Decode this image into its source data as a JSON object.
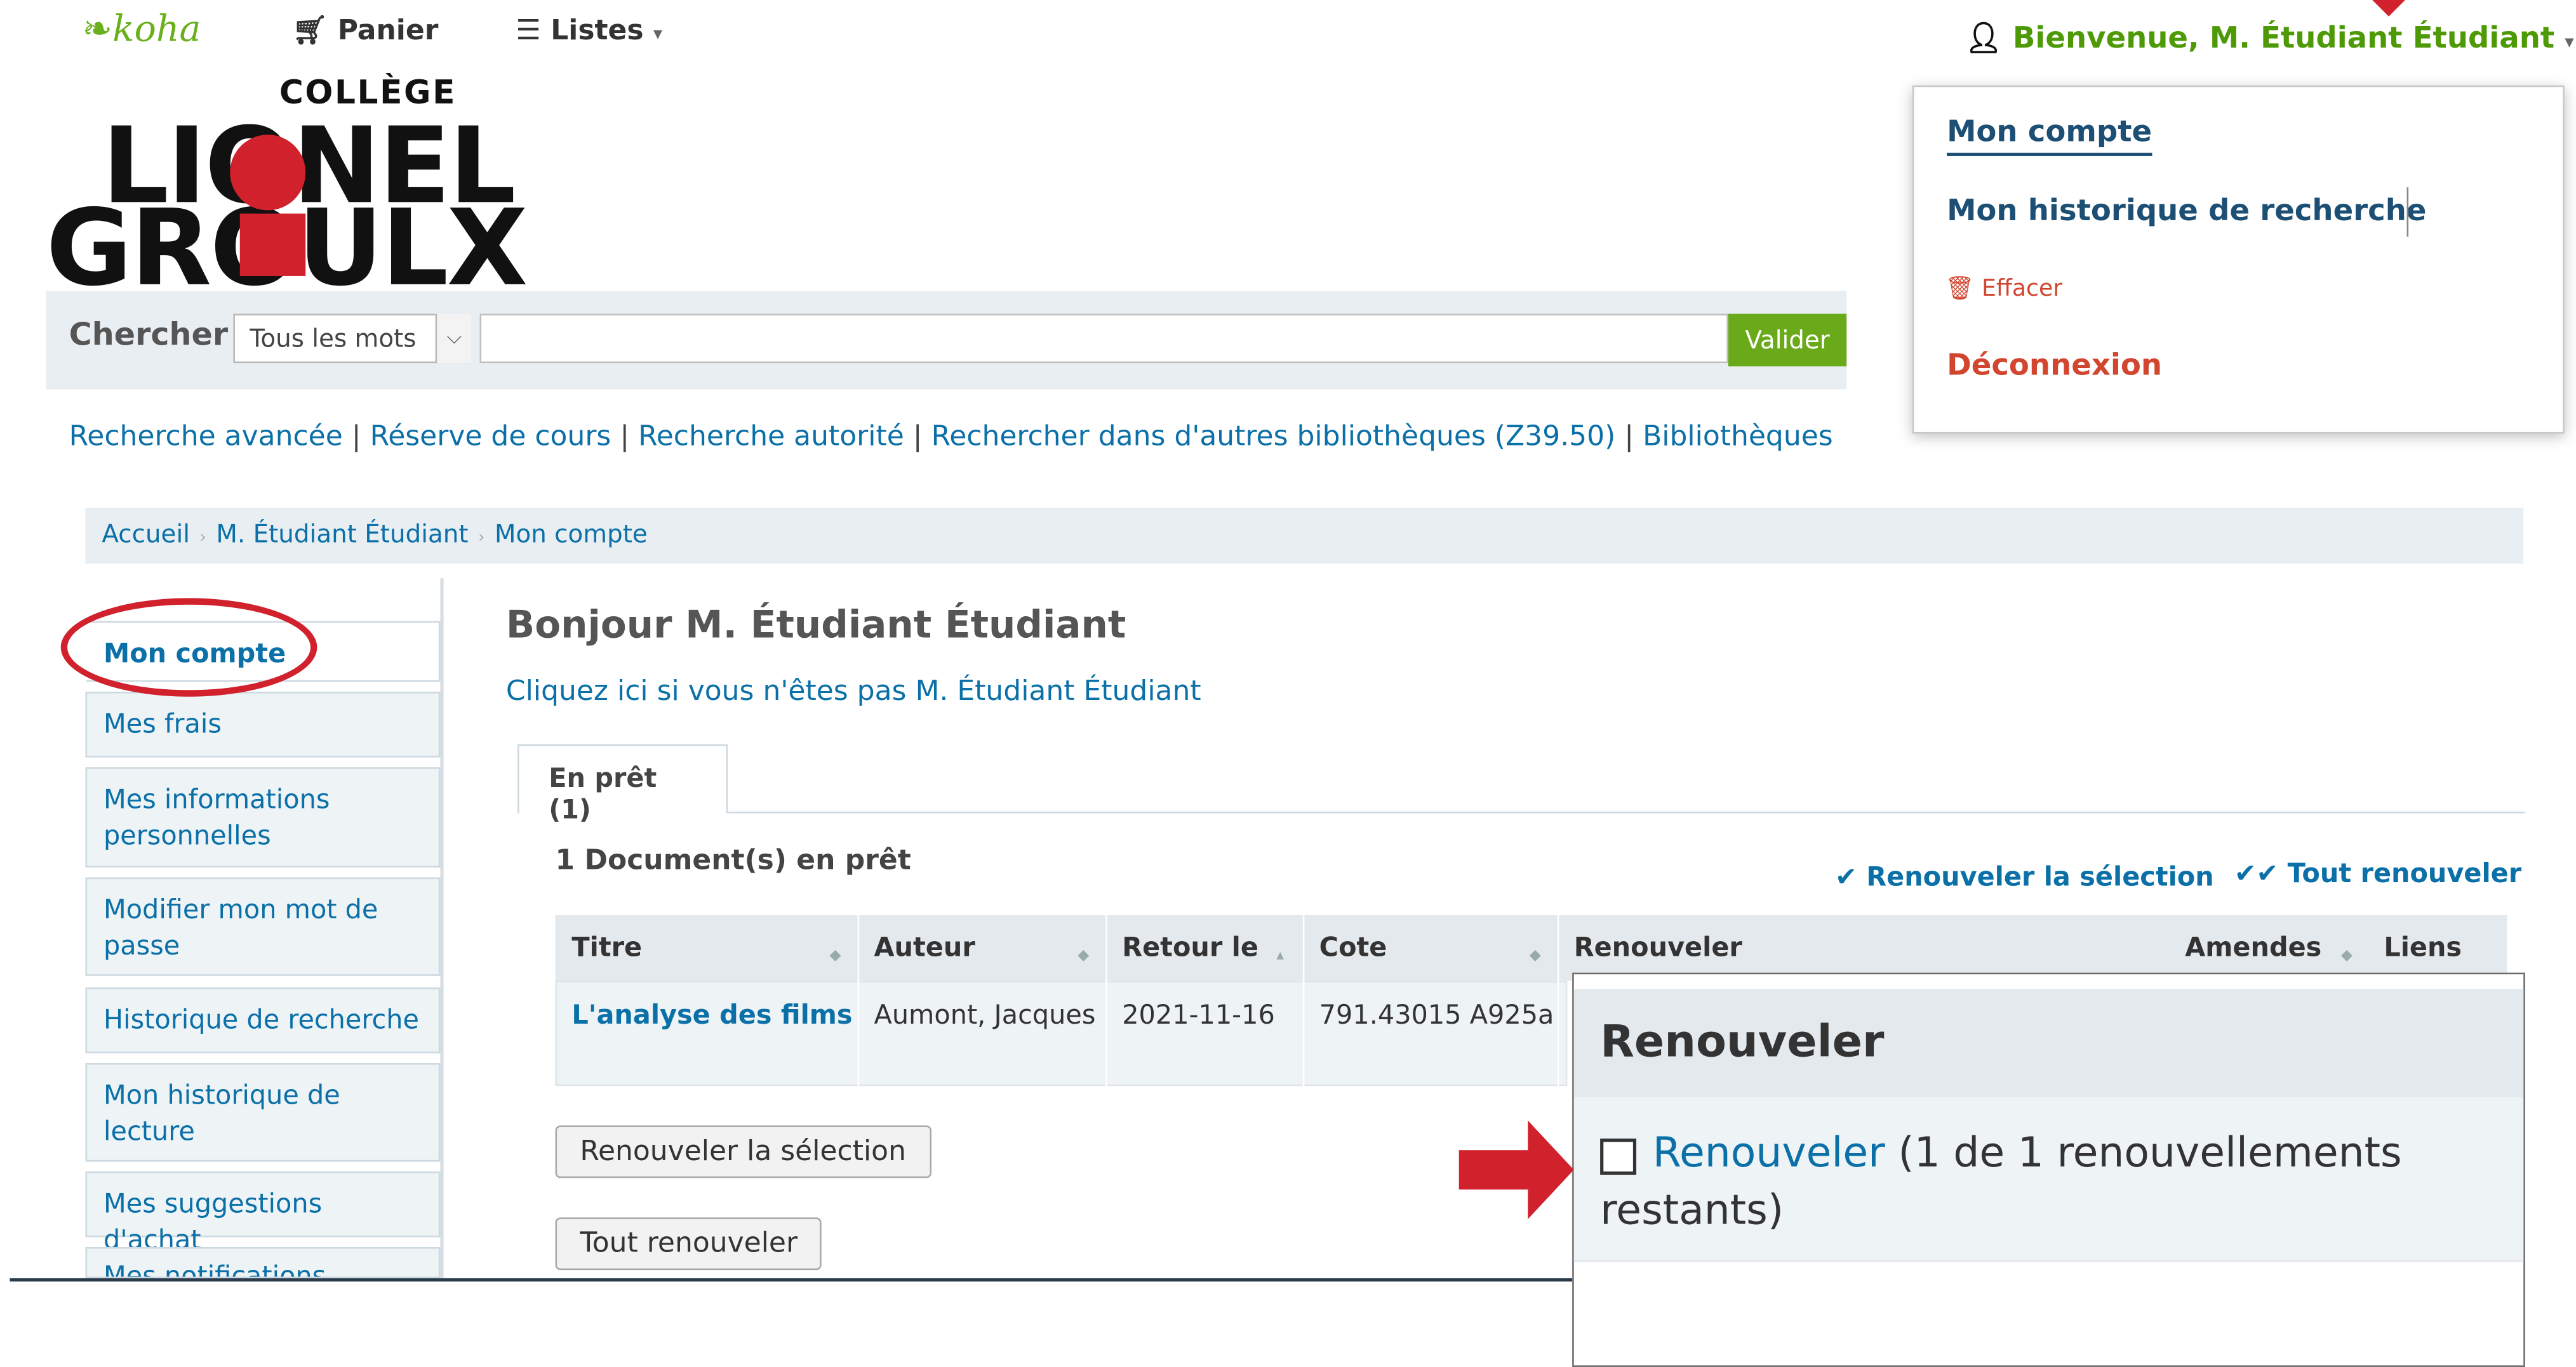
{
  "navbar": {
    "logo": "koha",
    "cart": "Panier",
    "lists": "Listes",
    "user_menu": "Bienvenue, M. Étudiant Étudiant"
  },
  "college_logo": {
    "small": "COLLÈGE",
    "line1": "LIONEL",
    "line2": "GROULX"
  },
  "search": {
    "label": "Chercher",
    "type_selected": "Tous les mots",
    "query": "",
    "submit": "Valider"
  },
  "sub_links": [
    "Recherche avancée",
    "Réserve de cours",
    "Recherche autorité",
    "Rechercher dans d'autres bibliothèques (Z39.50)",
    "Bibliothèques"
  ],
  "breadcrumb": [
    "Accueil",
    "M. Étudiant Étudiant",
    "Mon compte"
  ],
  "sidebar": {
    "items": [
      {
        "label": "Mon compte"
      },
      {
        "label": "Mes frais"
      },
      {
        "label": "Mes informations personnelles"
      },
      {
        "label": "Modifier mon mot de passe"
      },
      {
        "label": "Historique de recherche"
      },
      {
        "label": "Mon historique de lecture"
      },
      {
        "label": "Mes suggestions d'achat"
      },
      {
        "label": "Mes notifications"
      }
    ]
  },
  "main": {
    "greeting": "Bonjour M. Étudiant Étudiant",
    "not_you": "Cliquez ici si vous n'êtes pas M. Étudiant Étudiant",
    "tab": "En prêt (1)",
    "checkouts_count": "1 Document(s) en prêt",
    "renew_selected_link": "Renouveler la sélection",
    "renew_all_link": "Tout renouveler",
    "table": {
      "headers": [
        "Titre",
        "Auteur",
        "Retour le",
        "Cote",
        "Renouveler",
        "Amendes",
        "Liens"
      ],
      "rows": [
        {
          "title": "L'analyse des films",
          "author": "Aumont, Jacques",
          "due": "2021-11-16",
          "call_number": "791.43015 A925a"
        }
      ]
    },
    "renew_selected_button": "Renouveler la sélection",
    "renew_all_button": "Tout renouveler"
  },
  "user_dropdown": {
    "account": "Mon compte",
    "search_history": "Mon historique de recherche",
    "clear": "Effacer",
    "logout": "Déconnexion"
  },
  "renew_callout": {
    "title": "Renouveler",
    "link": "Renouveler",
    "remaining": "(1 de 1 renouvellements restants)"
  },
  "colors": {
    "koha_green": "#6aaf1c",
    "link_blue": "#0b70a8",
    "annotation_red": "#d0212c",
    "logout_red": "#d2452f"
  }
}
